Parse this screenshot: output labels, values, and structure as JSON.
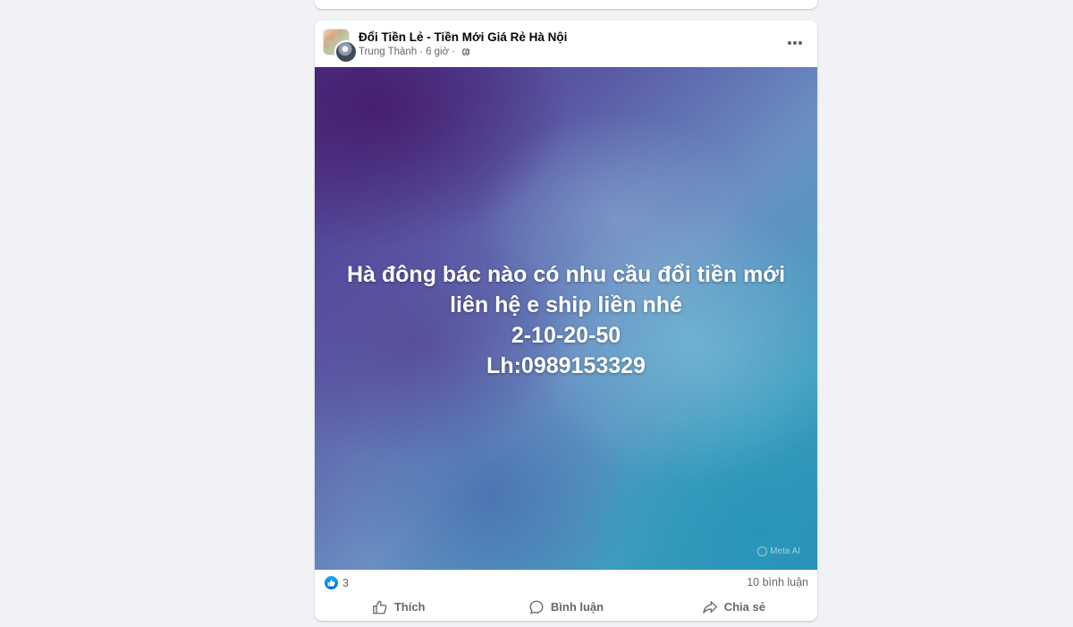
{
  "post": {
    "group_name": "Đổi Tiền Lẻ - Tiền Mới Giá Rẻ Hà Nội",
    "author": "Trung Thành",
    "separator": "·",
    "time": "6 giờ",
    "privacy_icon": "globe-icon",
    "body_lines": [
      "Hà đông bác nào có nhu cầu đổi tiền mới",
      "liên hệ e ship liền nhé",
      "2-10-20-50",
      "Lh:0989153329"
    ],
    "watermark": "Meta AI",
    "reaction_count": "3",
    "comment_count": "10 bình luận"
  },
  "actions": {
    "like": "Thích",
    "comment": "Bình luận",
    "share": "Chia sẻ"
  },
  "colors": {
    "page_bg": "#f0f2f5",
    "card_bg": "#ffffff",
    "secondary_text": "#65676b",
    "like_blue": "#0866ff"
  }
}
